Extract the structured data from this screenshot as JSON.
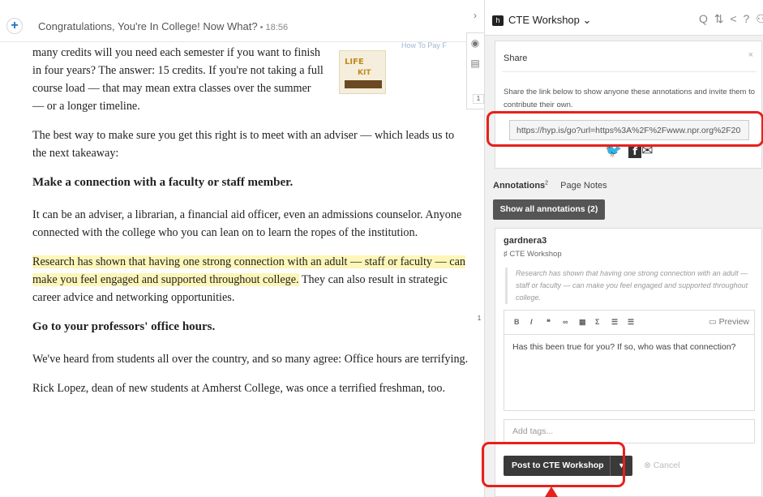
{
  "article_bar": {
    "add_symbol": "+",
    "title": "Congratulations, You're In College! Now What?",
    "time": " • 18:56"
  },
  "article": {
    "paragraph_1": "many credits will you need each semester if you want to finish in four years? The answer: 15 credits. If you're not taking a full course load — that may mean extra classes over the summer — or a longer timeline.",
    "paragraph_2": "The best way to make sure you get this right is to meet with an adviser — which leads us to the next takeaway:",
    "heading_1": "Make a connection with a faculty or staff member.",
    "paragraph_3": "It can be an adviser, a librarian, a financial aid officer, even an admissions counselor. Anyone connected with the college who you can lean on to learn the ropes of the institution.",
    "paragraph_4_highlight": "Research has shown that having one strong connection with an adult — staff or faculty — can make you feel engaged and supported throughout college.",
    "paragraph_4_rest": " They can also result in strategic career advice and networking opportunities.",
    "heading_2": "Go to your professors' office hours.",
    "paragraph_5": "We've heard from students all over the country, and so many agree: Office hours are terrifying.",
    "paragraph_6": "Rick Lopez, dean of new students at Amherst College, was once a terrified freshman, too.",
    "thumb_text_1": "LIFE",
    "thumb_text_2": "KIT",
    "pay_text": "How To Pay F"
  },
  "middle_toolbar": {
    "collapse_symbol": "›",
    "eye_symbol": "◉",
    "notes_symbol": "▤",
    "count_badge_top": "1",
    "count_badge_bottom": "1"
  },
  "sidebar": {
    "group_icon_letter": "h",
    "group_name": "CTE Workshop ⌄",
    "top_icons": "Q ⇅ < ? ⚇",
    "share": {
      "title": "Share",
      "close": "×",
      "description": "Share the link below to show anyone these annotations and invite them to contribute their own.",
      "link": "https://hyp.is/go?url=https%3A%2F%2Fwww.npr.org%2F20",
      "twitter": "🐦",
      "facebook": "f",
      "email": "✉"
    },
    "tabs": {
      "annotations_label": "Annotations",
      "annotations_count": "2",
      "page_notes_label": "Page Notes"
    },
    "show_all_button": "Show all annotations (2)",
    "annotation": {
      "user": "gardnera3",
      "group": "♯ CTE Workshop",
      "quote": "Research has shown that having one strong connection with an adult — staff or faculty — can make you feel engaged and supported throughout college.",
      "toolbar": {
        "bold": "B",
        "italic": "I",
        "quote": "❝",
        "link": "∞",
        "image": "▦",
        "math": "Σ",
        "numbered_list": "☰",
        "bulleted_list": "☰"
      },
      "preview_label": "▭ Preview",
      "editor_text": "Has this been true for you? If so, who was that connection?",
      "tags_placeholder": "Add tags...",
      "post_button": "Post to CTE Workshop",
      "post_caret": "▼",
      "cancel_button": "⊗ Cancel"
    }
  },
  "colors": {
    "highlight": "#fdf6b8",
    "annotation_red": "#e8201c",
    "sidebar_bg": "#f1f1f1",
    "dark_button": "#3a3a3a"
  }
}
